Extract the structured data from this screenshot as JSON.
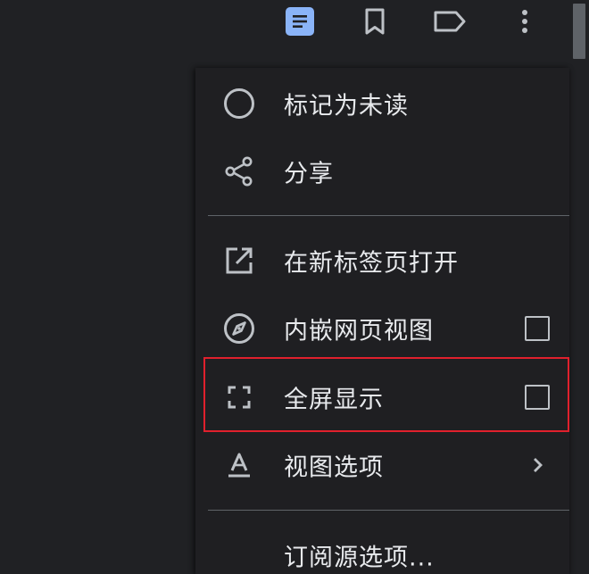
{
  "toolbar": {
    "buttons": [
      {
        "icon": "article-icon",
        "active": true,
        "color": "#8ab4f8"
      },
      {
        "icon": "bookmark-icon"
      },
      {
        "icon": "label-icon"
      },
      {
        "icon": "more-vert-icon"
      }
    ]
  },
  "menu": {
    "items": [
      {
        "label": "标记为未读",
        "icon": "circle-icon"
      },
      {
        "label": "分享",
        "icon": "share-icon"
      },
      {
        "label": "在新标签页打开",
        "icon": "open-in-new-icon"
      },
      {
        "label": "内嵌网页视图",
        "icon": "compass-icon",
        "checkbox": false
      },
      {
        "label": "全屏显示",
        "icon": "fullscreen-icon",
        "checkbox": false,
        "highlighted": true
      },
      {
        "label": "视图选项",
        "icon": "text-format-icon",
        "submenu": true
      },
      {
        "label": "订阅源选项...",
        "icon": ""
      }
    ]
  },
  "colors": {
    "background": "#202124",
    "menu_background": "#1f1f22",
    "text": "#e8eaed",
    "accent": "#8ab4f8",
    "highlight_border": "#e0202d"
  }
}
